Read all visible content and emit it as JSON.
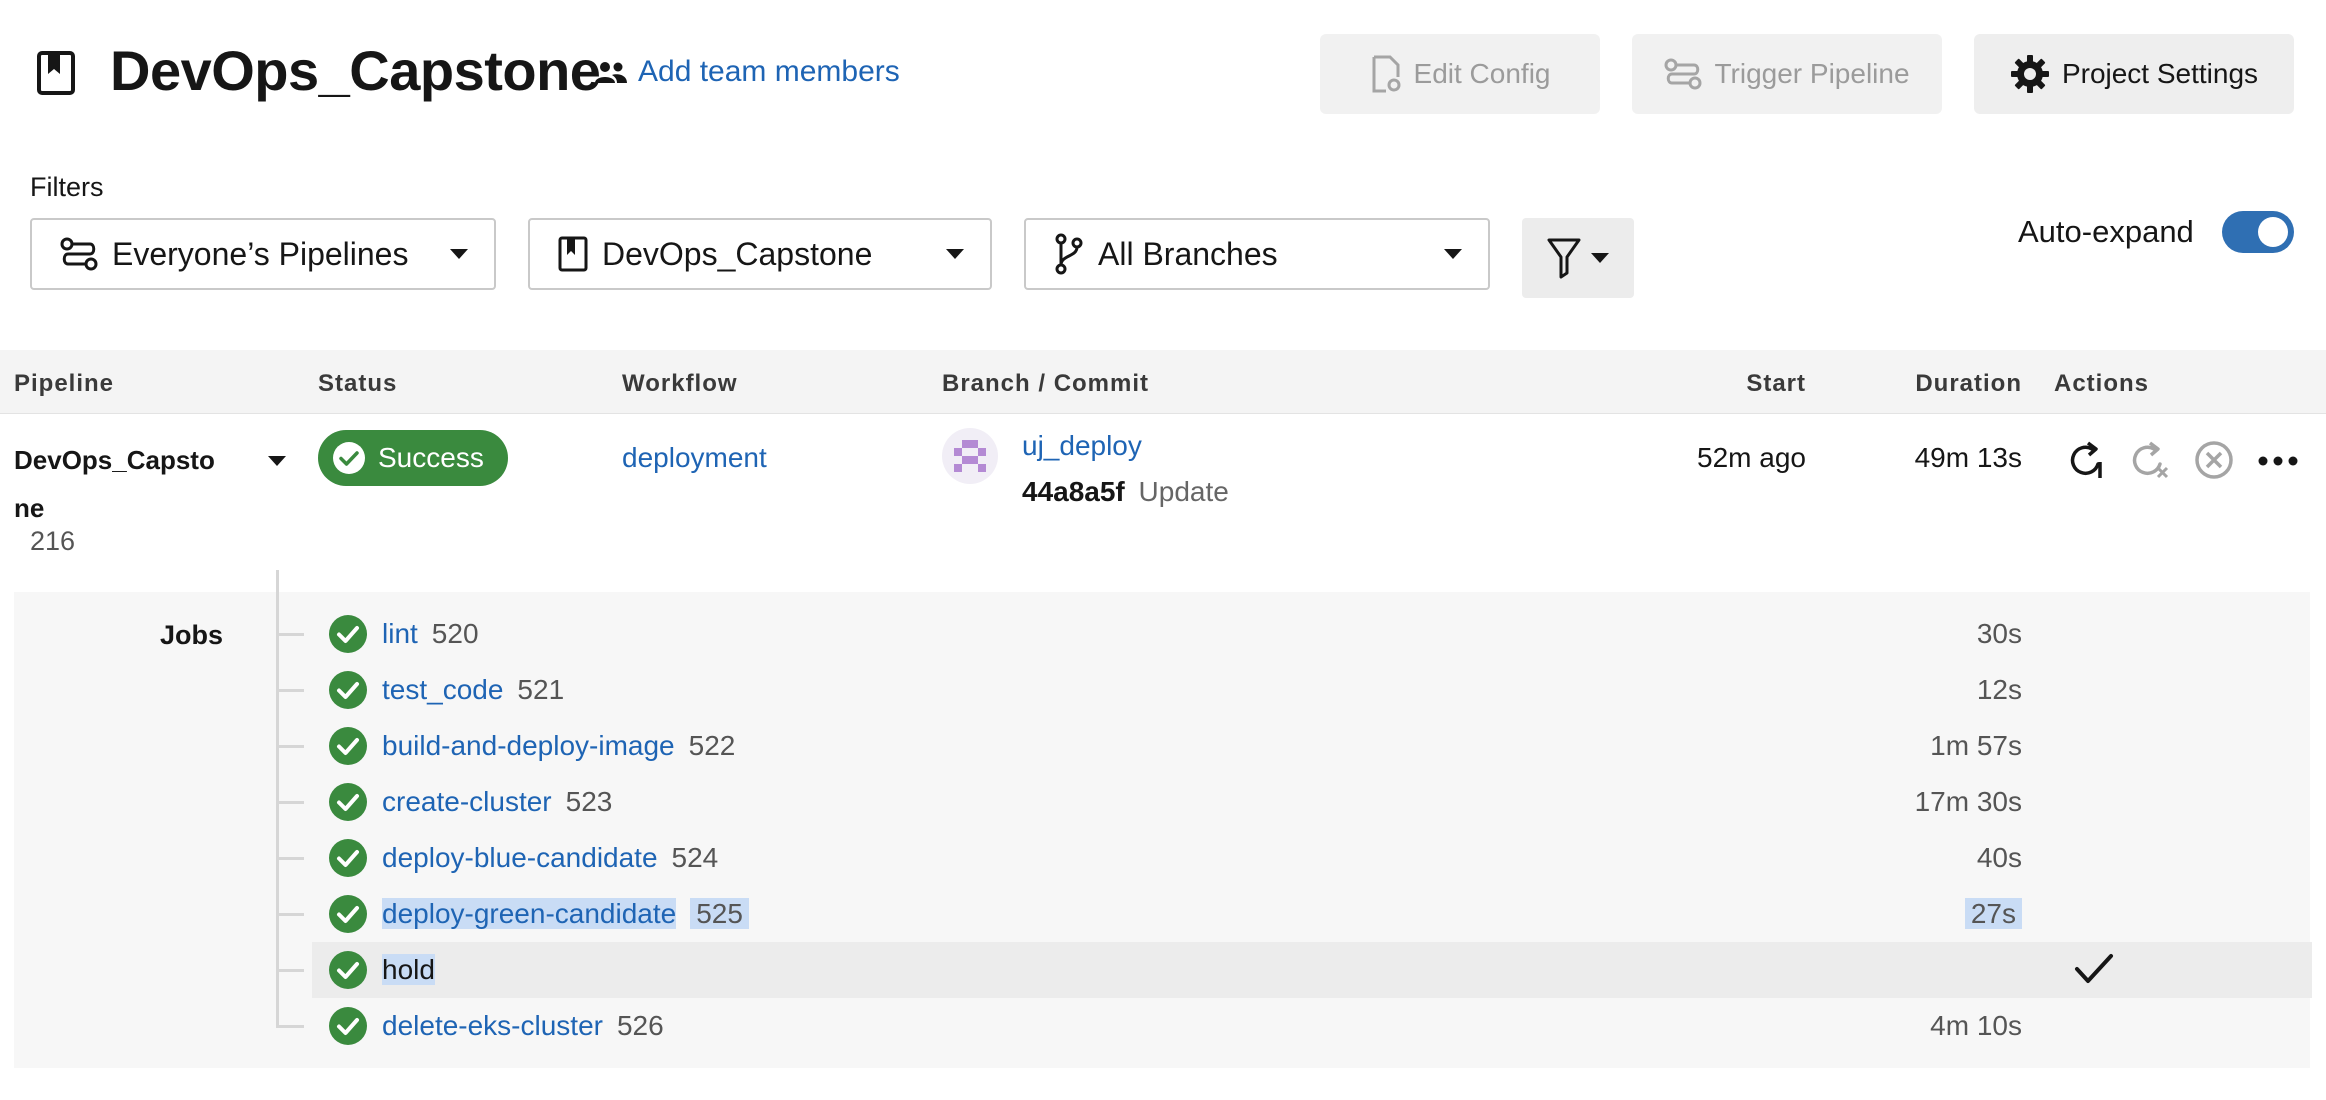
{
  "header": {
    "project_name": "DevOps_Capstone",
    "add_team_label": "Add team members",
    "buttons": {
      "edit_config": "Edit Config",
      "trigger_pipeline": "Trigger Pipeline",
      "project_settings": "Project Settings"
    }
  },
  "filters": {
    "label": "Filters",
    "pipelines_select": "Everyone’s Pipelines",
    "project_select": "DevOps_Capstone",
    "branch_select": "All Branches",
    "auto_expand_label": "Auto-expand",
    "auto_expand_on": true
  },
  "table": {
    "columns": {
      "pipeline": "Pipeline",
      "status": "Status",
      "workflow": "Workflow",
      "branch_commit": "Branch / Commit",
      "start": "Start",
      "duration": "Duration",
      "actions": "Actions"
    },
    "pipeline_row": {
      "name_line1": "DevOps_Capsto",
      "name_line2": "ne",
      "number": "216",
      "status": "Success",
      "workflow": "deployment",
      "branch": "uj_deploy",
      "commit_hash": "44a8a5f",
      "commit_message": "Update",
      "start": "52m ago",
      "duration": "49m 13s"
    }
  },
  "jobs": {
    "label": "Jobs",
    "items": [
      {
        "name": "lint",
        "number": "520",
        "duration": "30s"
      },
      {
        "name": "test_code",
        "number": "521",
        "duration": "12s"
      },
      {
        "name": "build-and-deploy-image",
        "number": "522",
        "duration": "1m 57s"
      },
      {
        "name": "create-cluster",
        "number": "523",
        "duration": "17m 30s"
      },
      {
        "name": "deploy-blue-candidate",
        "number": "524",
        "duration": "40s"
      },
      {
        "name": "deploy-green-candidate",
        "number": "525",
        "duration": "27s"
      },
      {
        "name": "hold",
        "number": "",
        "duration": ""
      },
      {
        "name": "delete-eks-cluster",
        "number": "526",
        "duration": "4m 10s"
      }
    ]
  },
  "colors": {
    "link": "#1e64b4",
    "success": "#3a8a3e",
    "toggle_on": "#2f6fb3",
    "selection": "#c9dcf5"
  },
  "icons": [
    "bookmark-icon",
    "people-icon",
    "file-gear-icon",
    "pipeline-icon",
    "gear-icon",
    "branch-icon",
    "filter-icon",
    "check-circle-icon",
    "rerun-icon",
    "rerun-failed-icon",
    "cancel-icon",
    "more-icon",
    "approve-check-icon"
  ]
}
